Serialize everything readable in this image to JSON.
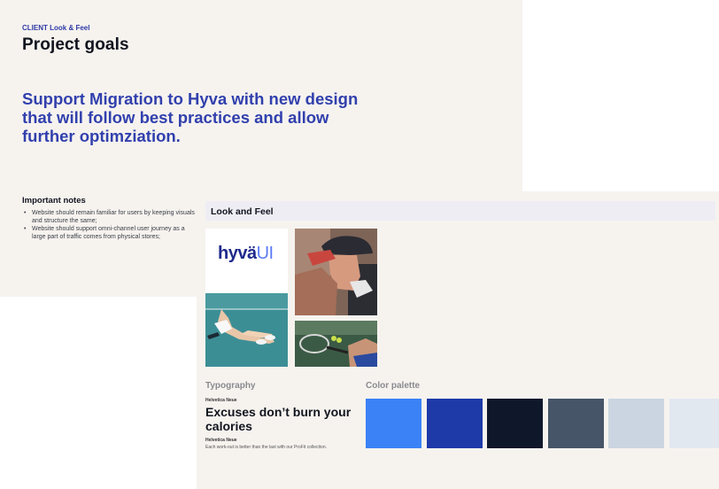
{
  "slide_goals": {
    "eyebrow": "CLIENT Look & Feel",
    "title": "Project goals",
    "goal_statement": "Support Migration to Hyva with new design that will follow best practices and allow further optimziation.",
    "notes_heading": "Important notes",
    "notes": [
      "Website should remain familiar for users by keeping visuals and structure the same;",
      "Website should support omni-channel user journey as a large part of traffic comes from physical stores;"
    ]
  },
  "slide_look": {
    "title": "Look and Feel",
    "logo": {
      "main": "hyvä",
      "accent": "UI"
    },
    "images": [
      "tennis-player-photo",
      "cyclist-drinking-photo",
      "tennis-racket-photo"
    ],
    "typography": {
      "label": "Typography",
      "font_name_1": "Helvetica Neue",
      "sample": "Excuses don’t burn your calories",
      "font_name_2": "Helvetica Neue",
      "body": "Each work-out is better than the last with our ProFit collection."
    },
    "palette": {
      "label": "Color palette",
      "colors": [
        "#3b82f6",
        "#1e3aa8",
        "#0f172a",
        "#475569",
        "#cbd5e1",
        "#e2e8f0"
      ]
    }
  }
}
